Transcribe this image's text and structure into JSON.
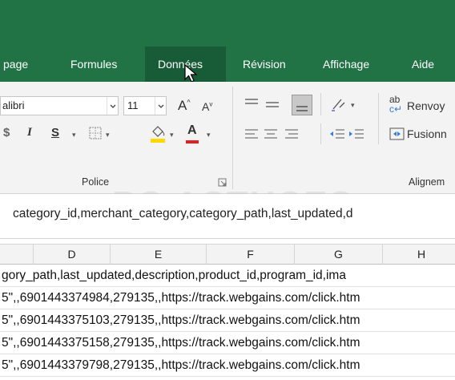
{
  "tabs": [
    {
      "label": "page",
      "active": false
    },
    {
      "label": "Formules",
      "active": false
    },
    {
      "label": "Données",
      "active": true
    },
    {
      "label": "Révision",
      "active": false
    },
    {
      "label": "Affichage",
      "active": false
    },
    {
      "label": "Aide",
      "active": false
    }
  ],
  "ribbon": {
    "font_name": "alibri",
    "font_size": "11",
    "grow_font": "A",
    "shrink_font": "A",
    "italic": "I",
    "underline": "S",
    "font_color_letter": "A",
    "wrap_text": "Renvoy",
    "merge_center": "Fusionn",
    "orientation_glyph": "ab",
    "groups": {
      "police": "Police",
      "alignment": "Alignem"
    }
  },
  "formula_bar": {
    "content": "category_id,merchant_category,category_path,last_updated,d"
  },
  "watermark": "PC ASTUCES",
  "columns": [
    "D",
    "E",
    "F",
    "G",
    "H"
  ],
  "rows": [
    "gory_path,last_updated,description,product_id,program_id,ima",
    "5\",,6901443374984,279135,,https://track.webgains.com/click.htm",
    "5\",,6901443375103,279135,,https://track.webgains.com/click.htm",
    "5\",,6901443375158,279135,,https://track.webgains.com/click.htm",
    "5\",,6901443379798,279135,,https://track.webgains.com/click.htm"
  ],
  "colors": {
    "ribbon_green": "#217346",
    "active_tab": "#185c37",
    "font_color_bar": "#e02020",
    "fill_color_bar": "#ffd800"
  }
}
